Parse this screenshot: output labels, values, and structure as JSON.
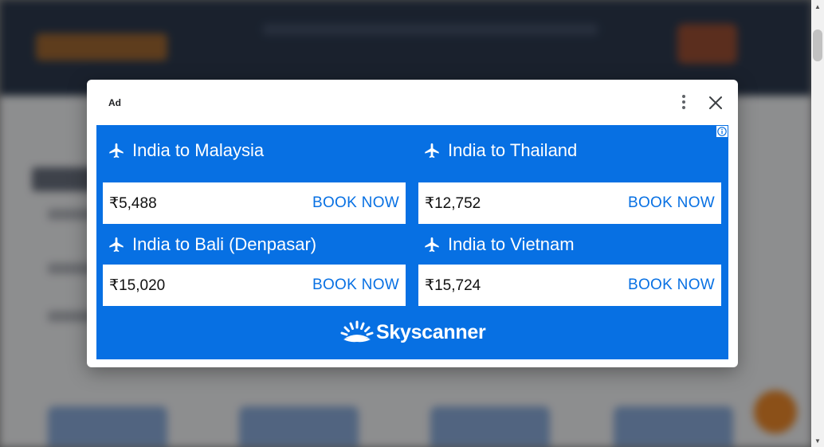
{
  "ad": {
    "label": "Ad",
    "brand_name": "Skyscanner",
    "colors": {
      "ad_background": "#0770e3",
      "button_text": "#0770e3",
      "card_background": "#ffffff"
    },
    "icons": {
      "menu": "kebab-menu-icon",
      "close": "close-icon",
      "info": "info-icon",
      "plane": "plane-icon",
      "brand": "skyscanner-sunrise-icon"
    },
    "routes": [
      {
        "title": "India to Malaysia",
        "price": "₹5,488",
        "cta": "BOOK NOW"
      },
      {
        "title": "India to Thailand",
        "price": "₹12,752",
        "cta": "BOOK NOW"
      },
      {
        "title": "India to Bali (Denpasar)",
        "price": "₹15,020",
        "cta": "BOOK NOW"
      },
      {
        "title": "India to Vietnam",
        "price": "₹15,724",
        "cta": "BOOK NOW"
      }
    ]
  }
}
